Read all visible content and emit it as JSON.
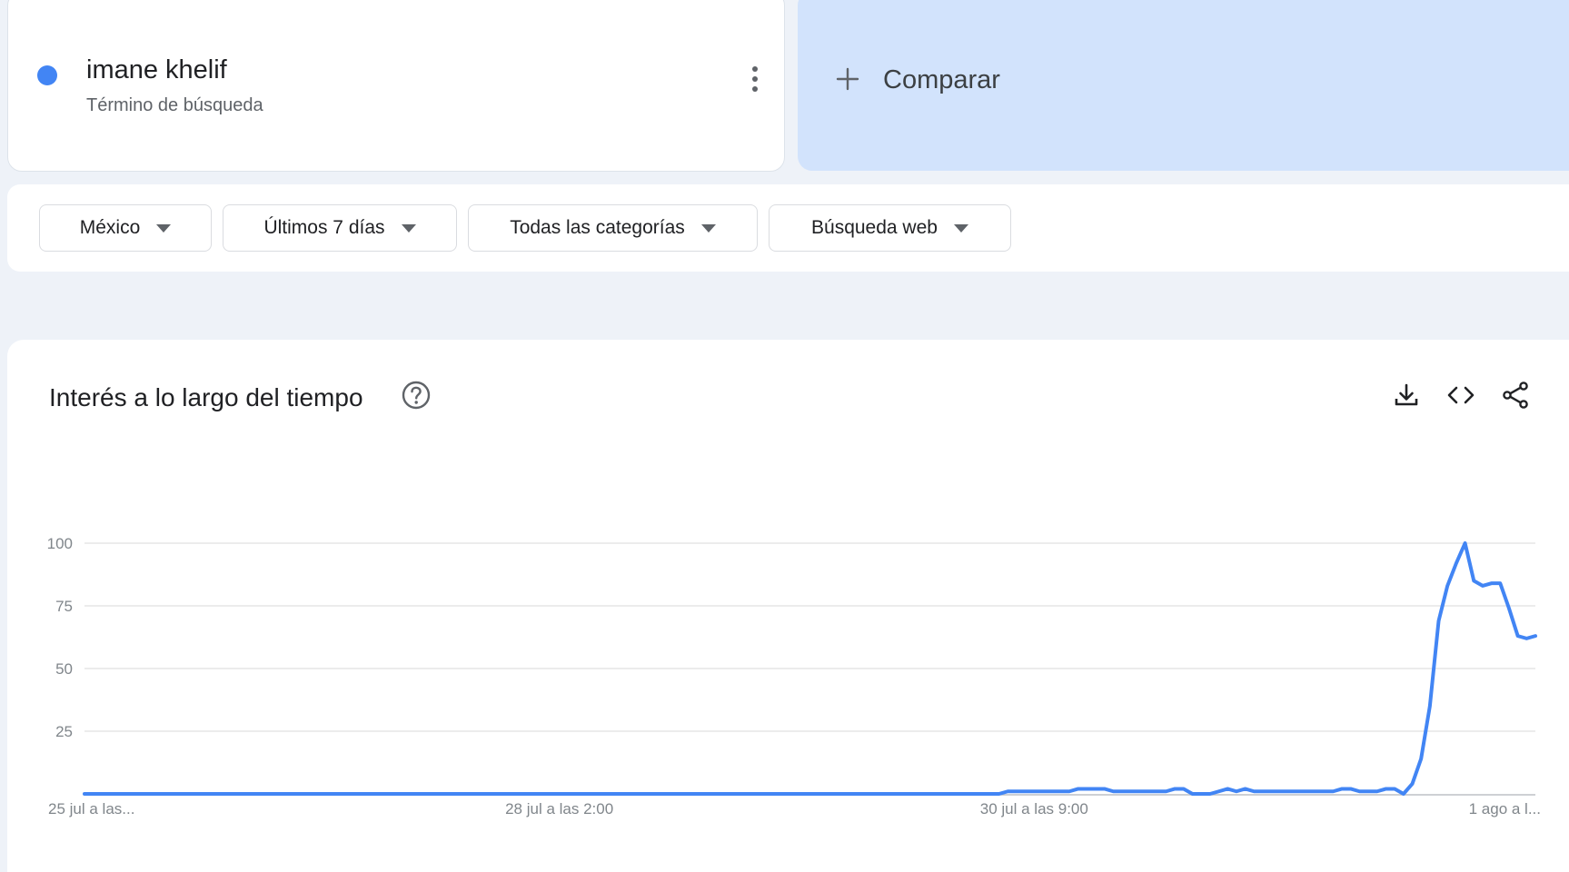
{
  "term": {
    "name": "imane khelif",
    "subtitle": "Término de búsqueda",
    "color": "#4285f4",
    "menu_icon": "more-vert-icon"
  },
  "compare": {
    "label": "Comparar",
    "icon": "plus-icon"
  },
  "filters": {
    "region": "México",
    "time": "Últimos 7 días",
    "category": "Todas las categorías",
    "search_type": "Búsqueda web"
  },
  "chart_section": {
    "title": "Interés a lo largo del tiempo",
    "help_icon": "help-circle-icon",
    "tools": [
      "download-icon",
      "embed-code-icon",
      "share-icon"
    ]
  },
  "chart_data": {
    "type": "line",
    "title": "",
    "xlabel": "",
    "ylabel": "",
    "ylim": [
      0,
      100
    ],
    "y_ticks": [
      25,
      50,
      75,
      100
    ],
    "grid": true,
    "x_tick_labels": [
      "25 jul a las...",
      "28 jul a las 2:00",
      "30 jul a las 9:00",
      "1 ago a l..."
    ],
    "x_tick_index": [
      0,
      54,
      108,
      162
    ],
    "series": [
      {
        "color": "#4285f4",
        "values": [
          0,
          0,
          0,
          0,
          0,
          0,
          0,
          0,
          0,
          0,
          0,
          0,
          0,
          0,
          0,
          0,
          0,
          0,
          0,
          0,
          0,
          0,
          0,
          0,
          0,
          0,
          0,
          0,
          0,
          0,
          0,
          0,
          0,
          0,
          0,
          0,
          0,
          0,
          0,
          0,
          0,
          0,
          0,
          0,
          0,
          0,
          0,
          0,
          0,
          0,
          0,
          0,
          0,
          0,
          0,
          0,
          0,
          0,
          0,
          0,
          0,
          0,
          0,
          0,
          0,
          0,
          0,
          0,
          0,
          0,
          0,
          0,
          0,
          0,
          0,
          0,
          0,
          0,
          0,
          0,
          0,
          0,
          0,
          0,
          0,
          0,
          0,
          0,
          0,
          0,
          0,
          0,
          0,
          0,
          0,
          0,
          0,
          0,
          0,
          0,
          0,
          0,
          0,
          0,
          0,
          1,
          1,
          1,
          1,
          1,
          1,
          1,
          1,
          2,
          2,
          2,
          2,
          1,
          1,
          1,
          1,
          1,
          1,
          1,
          2,
          2,
          0,
          0,
          0,
          1,
          2,
          1,
          2,
          1,
          1,
          1,
          1,
          1,
          1,
          1,
          1,
          1,
          1,
          2,
          2,
          1,
          1,
          1,
          2,
          2,
          0,
          4,
          14,
          35,
          69,
          83,
          92,
          100,
          85,
          83,
          84,
          84,
          74,
          63,
          62,
          63
        ]
      }
    ]
  }
}
